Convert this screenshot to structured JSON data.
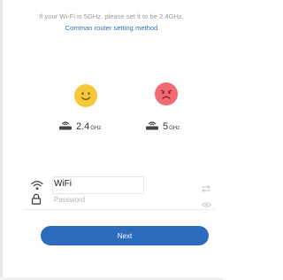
{
  "hint": {
    "text": "If your Wi-Fi is 5GHz, please set it to be 2.4GHz.",
    "link": "Comman router setting method"
  },
  "bands": [
    {
      "number": "2.4",
      "unit": "GHz",
      "status": "supported",
      "face_icon": "smiley-happy-icon",
      "color": "#f6c93a"
    },
    {
      "number": "5",
      "unit": "GHz",
      "status": "not-supported",
      "face_icon": "smiley-sad-icon",
      "color": "#f06b73"
    }
  ],
  "form": {
    "wifi": {
      "icon": "wifi-icon",
      "value": "WiFi",
      "action_icon": "swap-icon"
    },
    "password": {
      "icon": "lock-icon",
      "placeholder": "Password",
      "action_icon": "eye-icon"
    }
  },
  "next_button": {
    "label": "Next",
    "color": "#2d6bbf"
  }
}
